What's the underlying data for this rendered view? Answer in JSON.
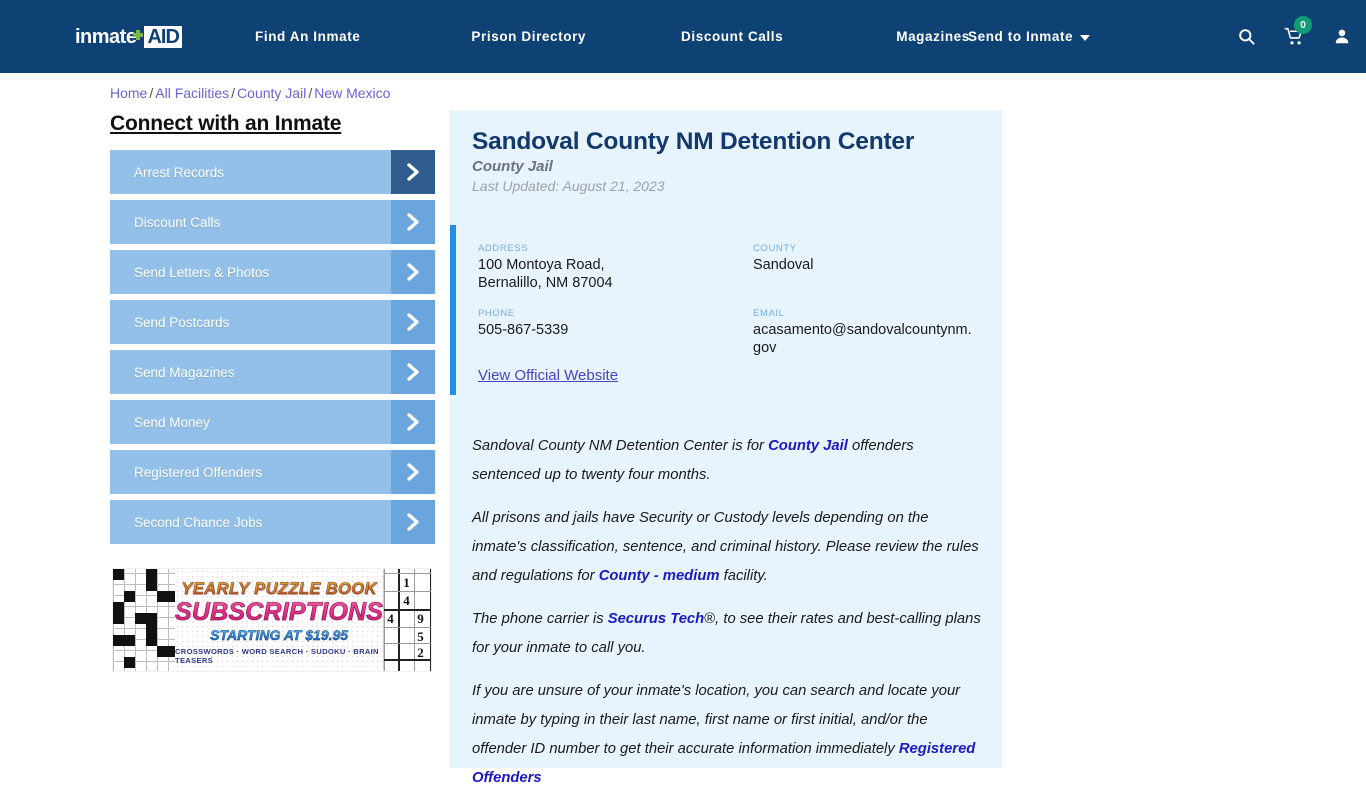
{
  "header": {
    "logo": {
      "part1": "inmate",
      "part2": "AID",
      "plus_icon": "green-plus-icon"
    },
    "nav": [
      {
        "label": "Find An Inmate"
      },
      {
        "label": "Prison Directory"
      },
      {
        "label": "Discount Calls"
      },
      {
        "label": "Magazines"
      }
    ],
    "send_to_inmate": "Send to Inmate",
    "icons": {
      "search": "search-icon",
      "cart": "shopping-cart-icon",
      "cart_count": "0",
      "account": "user-account-icon"
    },
    "colors": {
      "nav_bg": "#0f4274",
      "badge": "#0f9d73"
    }
  },
  "breadcrumb": {
    "items": [
      "Home",
      "All Facilities",
      "County Jail",
      "New Mexico"
    ],
    "separator": "/"
  },
  "sidebar": {
    "heading": "Connect with an Inmate",
    "items": [
      {
        "label": "Arrest Records"
      },
      {
        "label": "Discount Calls"
      },
      {
        "label": "Send Letters & Photos"
      },
      {
        "label": "Send Postcards"
      },
      {
        "label": "Send Magazines"
      },
      {
        "label": "Send Money"
      },
      {
        "label": "Registered Offenders"
      },
      {
        "label": "Second Chance Jobs"
      }
    ],
    "colors": {
      "button": "#93c0e8",
      "arrow": "#6ba5dd",
      "arrow_active": "#2e5d8e"
    }
  },
  "ad": {
    "line1": "YEARLY PUZZLE BOOK",
    "line2": "SUBSCRIPTIONS",
    "line3": "STARTING AT $19.95",
    "line4": "CROSSWORDS · WORD SEARCH · SUDOKU · BRAIN TEASERS",
    "sudoku_digits": [
      "1",
      "4",
      "4",
      "9",
      "5",
      "2"
    ]
  },
  "facility": {
    "title": "Sandoval County NM Detention Center",
    "type": "County Jail",
    "last_updated": "Last Updated: August 21, 2023",
    "fields": {
      "address_label": "ADDRESS",
      "address_line1": "100 Montoya Road,",
      "address_line2": "Bernalillo, NM 87004",
      "county_label": "COUNTY",
      "county_value": "Sandoval",
      "phone_label": "PHONE",
      "phone_value": "505-867-5339",
      "email_label": "EMAIL",
      "email_value": "acasamento@sandovalcountynm.gov"
    },
    "official_website_link": "View Official Website",
    "accent_color": "#1f8fe8",
    "panel_bg": "#e8f4fd"
  },
  "description": {
    "p1_a": "Sandoval County NM Detention Center is for ",
    "p1_link": "County Jail",
    "p1_b": " offenders sentenced up to twenty four months.",
    "p2_a": "All prisons and jails have Security or Custody levels depending on the inmate's classification, sentence, and criminal history. Please review the rules and regulations for ",
    "p2_link": "County - medium",
    "p2_b": " facility.",
    "p3_a": "The phone carrier is ",
    "p3_link": "Securus Tech",
    "p3_b": ", to see their rates and best-calling plans for your inmate to call you.",
    "p4_a": "If you are unsure of your inmate's location, you can search and locate your inmate by typing in their last name, first name or first initial, and/or the offender ID number to get their accurate information immediately ",
    "p4_link": "Registered Offenders"
  }
}
